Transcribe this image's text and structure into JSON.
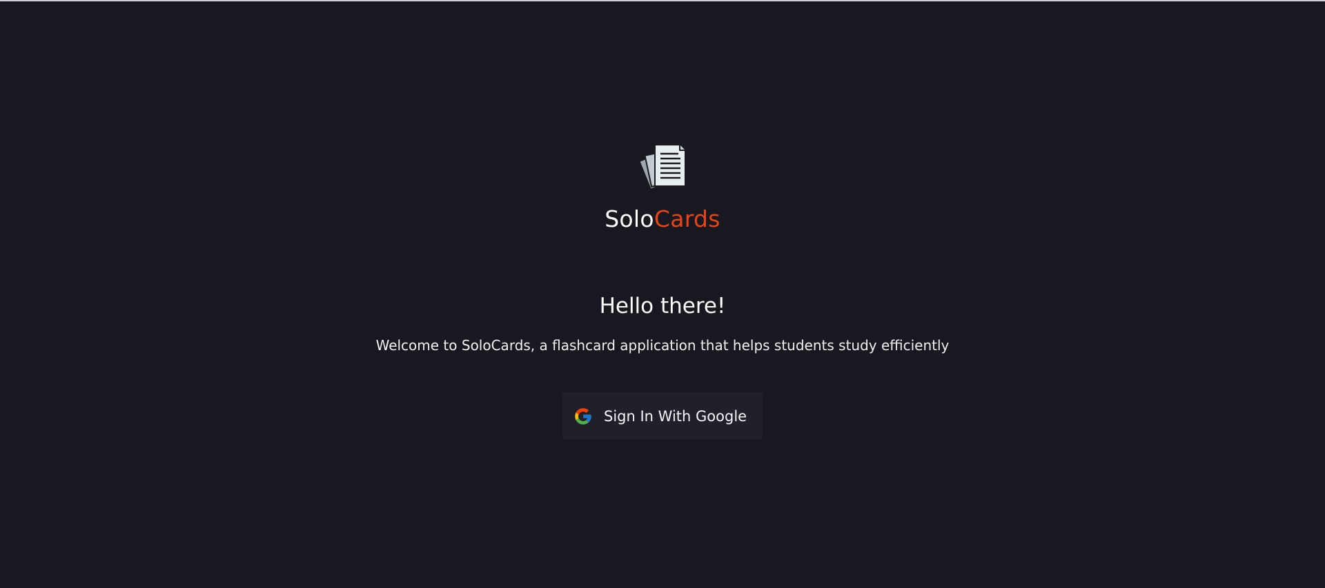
{
  "brand": {
    "icon": "stacked-documents-icon",
    "name_part1": "Solo",
    "name_part2": "Cards",
    "accent_color": "#e8441a"
  },
  "hero": {
    "greeting": "Hello there!",
    "tagline": "Welcome to SoloCards, a flashcard application that helps students study efficiently"
  },
  "signin": {
    "label": "Sign In With Google",
    "icon": "google-g-icon"
  },
  "colors": {
    "background": "#181820",
    "button_background": "#20202a",
    "text": "#ffffff"
  }
}
